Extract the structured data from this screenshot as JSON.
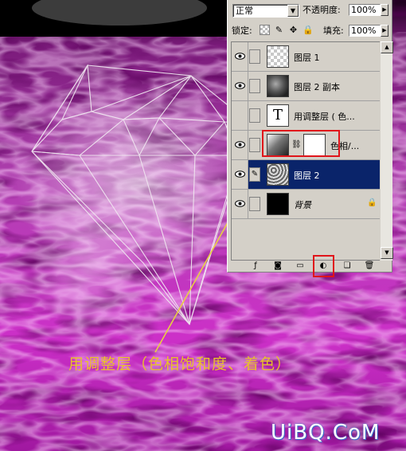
{
  "panel": {
    "blend_mode": "正常",
    "opacity_label": "不透明度:",
    "opacity_value": "100%",
    "lock_label": "锁定:",
    "fill_label": "填充:",
    "fill_value": "100%"
  },
  "layers": [
    {
      "name": "图层 1",
      "thumb": "transparent-checker"
    },
    {
      "name": "图层 2 副本",
      "thumb": "grey-cloud"
    },
    {
      "name": "用调整层 ( 色...",
      "thumb": "text-T"
    },
    {
      "name": "色相/...",
      "thumb": "adjustment-hue-saturation"
    },
    {
      "name": "图层 2",
      "thumb": "grey-texture",
      "selected": true
    },
    {
      "name": "背景",
      "thumb": "black",
      "locked": true
    }
  ],
  "bottom_toolbar": [
    "layer-style-icon",
    "layer-mask-icon",
    "new-group-icon",
    "adjustment-layer-icon",
    "new-layer-icon",
    "trash-icon"
  ],
  "annotation": {
    "caption": "用调整层（色相饱和度、着色）",
    "highlight_color": "#e0141a",
    "caption_color": "#e8c12a"
  },
  "watermark": "UiBQ.CoM",
  "colors": {
    "flame": "#cc22cc",
    "selection": "#0a246a"
  }
}
